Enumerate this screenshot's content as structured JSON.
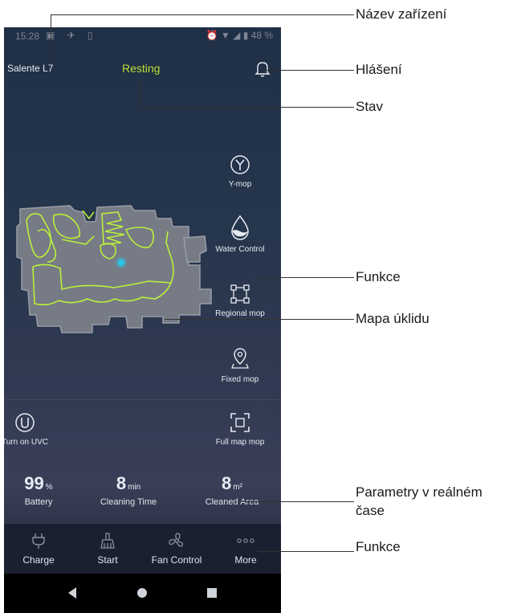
{
  "status_bar": {
    "time": "15:28",
    "battery": "48 %"
  },
  "header": {
    "device_name": "Salente L7",
    "state": "Resting"
  },
  "functions": [
    {
      "icon": "y-mop-icon",
      "label": "Y-mop"
    },
    {
      "icon": "water-drop-icon",
      "label": "Water Control"
    },
    {
      "icon": "regional-mop-icon",
      "label": "Regional mop"
    },
    {
      "icon": "fixed-mop-icon",
      "label": "Fixed mop"
    }
  ],
  "uvc": {
    "label": "Turn on UVC"
  },
  "full_map": {
    "label": "Full map mop"
  },
  "metrics": {
    "battery": {
      "value": "99",
      "unit": "%",
      "label": "Battery"
    },
    "time": {
      "value": "8",
      "unit": "min",
      "label": "Cleaning Time"
    },
    "area": {
      "value": "8",
      "unit": "m²",
      "label": "Cleaned Area"
    }
  },
  "bottom_nav": [
    {
      "icon": "plug-icon",
      "label": "Charge"
    },
    {
      "icon": "broom-icon",
      "label": "Start"
    },
    {
      "icon": "fan-icon",
      "label": "Fan Control"
    },
    {
      "icon": "more-dots-icon",
      "label": "More"
    }
  ],
  "annotations": {
    "device_name": "Název zařízení",
    "notifications": "Hlášení",
    "status": "Stav",
    "functions": "Funkce",
    "cleaning_map": "Mapa úklidu",
    "realtime_params_line1": "Parametry v reálném",
    "realtime_params_line2": "čase",
    "functions2": "Funkce"
  },
  "colors": {
    "accent": "#b6e236",
    "background_top": "#1f2f45",
    "nav_bg": "#1b2030",
    "map_floor": "#777b86",
    "map_path": "#b9f03a",
    "robot": "#27c7e6"
  }
}
